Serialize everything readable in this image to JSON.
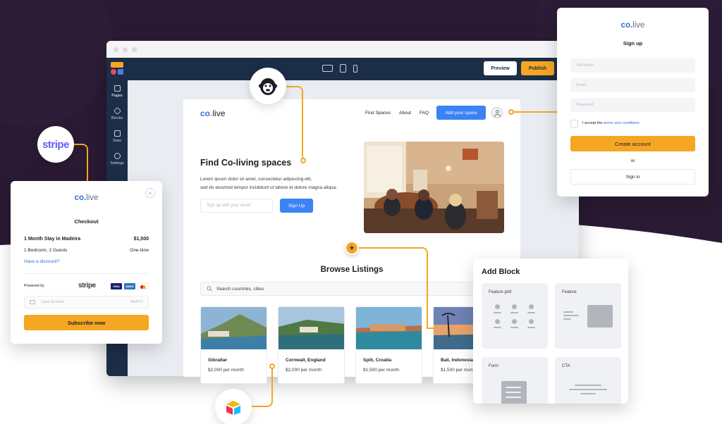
{
  "colors": {
    "dark_bg": "#2a1a33",
    "accent": "#f5a623",
    "blue": "#3b82f6",
    "navy": "#1c2d48"
  },
  "editor": {
    "preview_label": "Preview",
    "publish_label": "Publish",
    "sidebar": [
      {
        "label": "Pages",
        "icon": "pages-icon"
      },
      {
        "label": "Blocks",
        "icon": "blocks-icon"
      },
      {
        "label": "Data",
        "icon": "data-icon"
      },
      {
        "label": "Settings",
        "icon": "settings-icon"
      }
    ]
  },
  "site": {
    "brand_main": "co",
    "brand_dot": ".",
    "brand_rest": "live",
    "nav": [
      "Find Spaces",
      "About",
      "FAQ"
    ],
    "add_space_label": "Add your space",
    "hero_title": "Find Co-living spaces",
    "hero_text_1": "Lorem ipsum dolor sit amet, consectetur adipiscing elit,",
    "hero_text_2": "sed do eiusmod tempor incididunt ut labore et dolore magna aliqua.",
    "email_placeholder": "Sign up with your email",
    "signup_label": "Sign Up",
    "browse_title": "Browse Listings",
    "search_placeholder": "Search countries, cities",
    "listings": [
      {
        "name": "Gibraltar",
        "price": "$2,000 per month"
      },
      {
        "name": "Cornwall, England",
        "price": "$2,000 per month"
      },
      {
        "name": "Split, Croatia",
        "price": "$1,500 per month"
      },
      {
        "name": "Bali, Indonesia",
        "price": "$1,500 per month"
      }
    ]
  },
  "integrations": {
    "stripe": "stripe"
  },
  "checkout": {
    "brand_main": "co",
    "brand_dot": ".",
    "brand_rest": "live",
    "title": "Checkout",
    "item_name": "1 Month Stay in Madeira",
    "item_price": "$1,500",
    "item_detail": "1 Bedroom, 2 Guests",
    "item_term": "One-time",
    "discount_link": "Have a discount?",
    "powered_by": "Powered by",
    "stripe_word": "stripe",
    "card_badges": [
      "VISA",
      "AMEX",
      "MC"
    ],
    "card_placeholder": "Card Number",
    "expiry_placeholder": "MM/YY",
    "subscribe_label": "Subscribe now",
    "close_glyph": "×"
  },
  "signup": {
    "brand_main": "co",
    "brand_dot": ".",
    "brand_rest": "live",
    "title": "Sign up",
    "full_name_placeholder": "Full Name",
    "email_placeholder": "Email",
    "password_placeholder": "Password",
    "terms_prefix": "I accept the",
    "terms_link": "terms and conditions",
    "create_label": "Create account",
    "or_label": "or",
    "signin_label": "Sign in"
  },
  "add_block": {
    "title": "Add Block",
    "tiles": [
      "Feature grid",
      "Feature",
      "Form",
      "CTA"
    ]
  },
  "plus_glyph": "+"
}
